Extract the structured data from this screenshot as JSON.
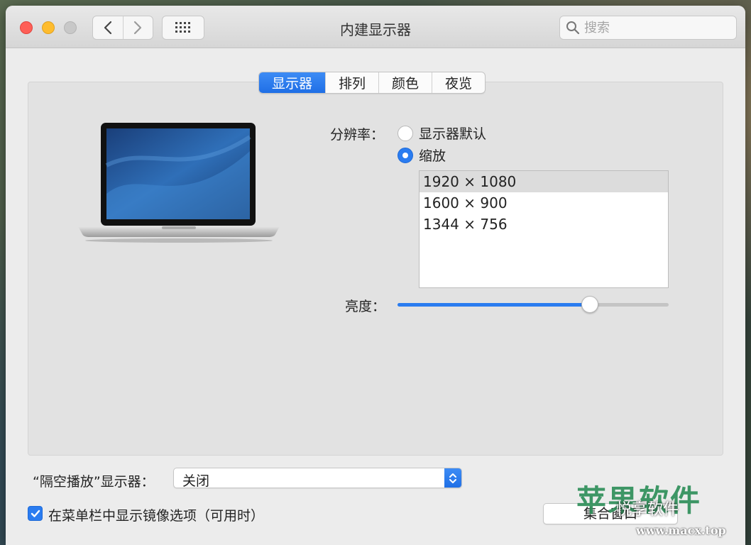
{
  "window": {
    "title": "内建显示器",
    "search_placeholder": "搜索"
  },
  "icons": {
    "back": "chevron-left-icon",
    "forward": "chevron-right-icon",
    "grid": "grid-icon",
    "search": "search-icon"
  },
  "tabs": [
    {
      "label": "显示器",
      "active": true
    },
    {
      "label": "排列",
      "active": false
    },
    {
      "label": "颜色",
      "active": false
    },
    {
      "label": "夜览",
      "active": false
    }
  ],
  "display": {
    "resolution_label": "分辨率：",
    "option_default": "显示器默认",
    "option_scaled": "缩放",
    "selected_option": "缩放",
    "resolutions": [
      "1920 × 1080",
      "1600 × 900",
      "1344 × 756"
    ],
    "selected_resolution": "1920 × 1080",
    "brightness_label": "亮度：",
    "brightness_level": 0.71
  },
  "airplay": {
    "label": "“隔空播放”显示器：",
    "value": "关闭"
  },
  "mirroring": {
    "label": "在菜单栏中显示镜像选项（可用时）",
    "checked": true
  },
  "button": {
    "gather_windows": "集合窗口"
  },
  "watermark": {
    "logo": "苹果软件",
    "wechat": "悦享软件",
    "url": "www.macx.top"
  },
  "colors": {
    "accent": "#2a7cf0",
    "close": "#fe5f57",
    "minimize": "#febc2e",
    "zoom_disabled": "#c8c8c8"
  }
}
